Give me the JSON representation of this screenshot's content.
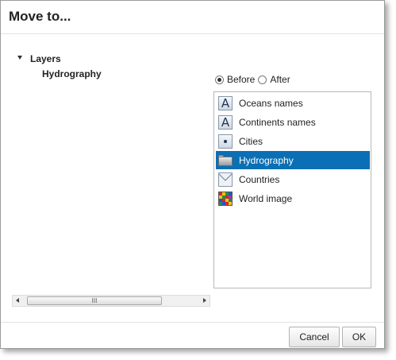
{
  "dialog": {
    "title": "Move to...",
    "tree": {
      "root_label": "Layers",
      "child_label": "Hydrography"
    },
    "hscroll": {
      "thumb_grip": "III"
    },
    "position": {
      "before_label": "Before",
      "after_label": "After",
      "selected": "Before"
    },
    "layers": [
      {
        "label": "Oceans names",
        "icon": "text-layer-icon",
        "selected": false
      },
      {
        "label": "Continents names",
        "icon": "text-layer-icon",
        "selected": false
      },
      {
        "label": "Cities",
        "icon": "point-layer-icon",
        "selected": false
      },
      {
        "label": "Hydrography",
        "icon": "folder-icon",
        "selected": true
      },
      {
        "label": "Countries",
        "icon": "polygon-layer-icon",
        "selected": false
      },
      {
        "label": "World image",
        "icon": "raster-layer-icon",
        "selected": false
      }
    ],
    "text_icon_glyph": "A",
    "buttons": {
      "cancel": "Cancel",
      "ok": "OK"
    },
    "colors": {
      "selection": "#0a6fb4",
      "selection_text": "#ffffff"
    }
  }
}
